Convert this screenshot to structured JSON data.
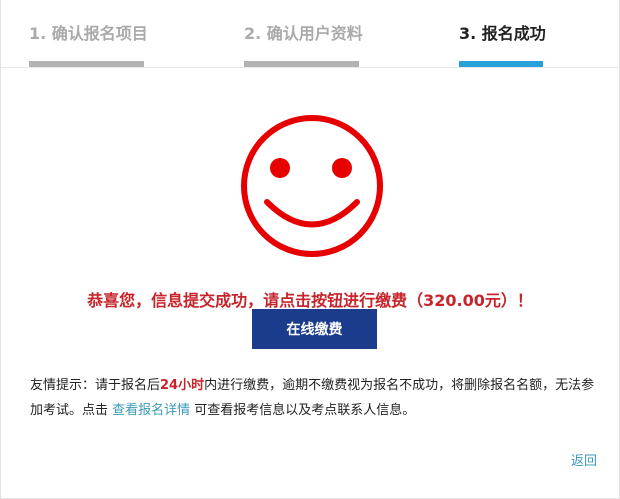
{
  "steps": [
    {
      "label": "1. 确认报名项目",
      "state": "done"
    },
    {
      "label": "2. 确认用户资料",
      "state": "done"
    },
    {
      "label": "3. 报名成功",
      "state": "active"
    }
  ],
  "colors": {
    "accent_blue": "#2aa0d8",
    "step_gray": "#b2b2b2",
    "success_red": "#c7242b",
    "button_blue": "#1b3b8c",
    "link_teal": "#3a9ab8"
  },
  "icon": {
    "name": "smiley-face-icon",
    "color": "#e60000"
  },
  "message": "恭喜您，信息提交成功，请点击按钮进行缴费（320.00元）！",
  "pay_button_label": "在线缴费",
  "notice": {
    "prefix": "友情提示：请于报名后",
    "highlight": "24小时",
    "middle": "内进行缴费，逾期不缴费视为报名不成功，将删除报名名额，无法参加考试。点击 ",
    "link": "查看报名详情",
    "suffix": " 可查看报考信息以及考点联系人信息。"
  },
  "back_link": "返回"
}
